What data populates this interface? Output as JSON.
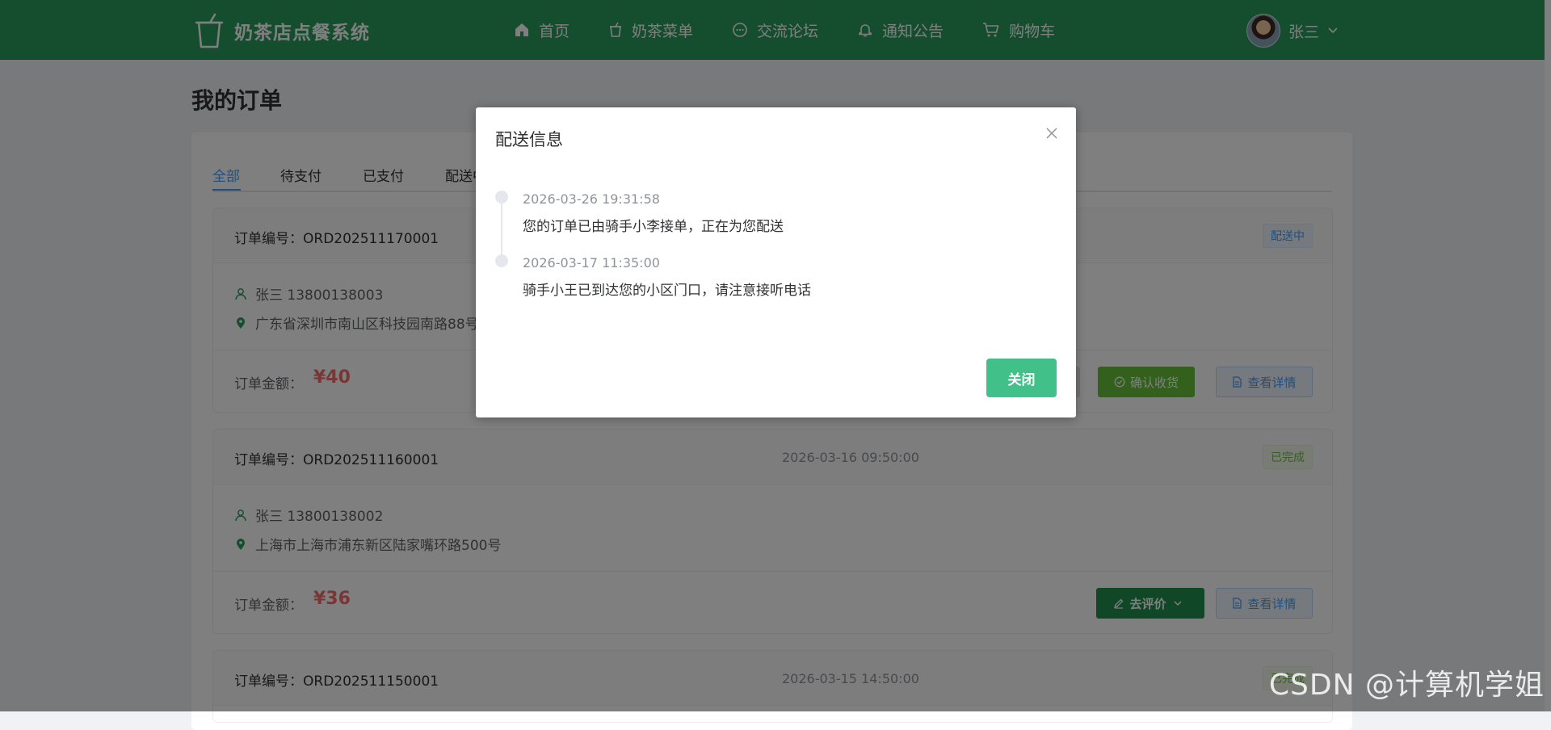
{
  "header": {
    "app_title": "奶茶店点餐系统",
    "nav": [
      {
        "label": "首页",
        "icon": "home-icon"
      },
      {
        "label": "奶茶菜单",
        "icon": "cup-icon"
      },
      {
        "label": "交流论坛",
        "icon": "chat-icon"
      },
      {
        "label": "通知公告",
        "icon": "bell-icon"
      },
      {
        "label": "购物车",
        "icon": "cart-icon"
      }
    ],
    "user_name": "张三"
  },
  "page": {
    "title": "我的订单",
    "tabs": [
      "全部",
      "待支付",
      "已支付",
      "配送中"
    ],
    "active_tab": "全部"
  },
  "orders": [
    {
      "label_no": "订单编号：",
      "order_no": "ORD202511170001",
      "time": "",
      "status": "配送中",
      "name_phone": "张三 13800138003",
      "address": "广东省深圳市南山区科技园南路88号",
      "amount_label": "订单金额：",
      "amount": "¥40",
      "action": "确认收货",
      "detail": "查看详情"
    },
    {
      "label_no": "订单编号：",
      "order_no": "ORD202511160001",
      "time": "2026-03-16 09:50:00",
      "status": "已完成",
      "name_phone": "张三 13800138002",
      "address": "上海市上海市浦东新区陆家嘴环路500号",
      "amount_label": "订单金额：",
      "amount": "¥36",
      "action": "去评价",
      "detail": "查看详情"
    },
    {
      "label_no": "订单编号：",
      "order_no": "ORD202511150001",
      "time": "2026-03-15 14:50:00",
      "status": "已完成"
    }
  ],
  "dialog": {
    "title": "配送信息",
    "events": [
      {
        "time": "2026-03-26 19:31:58",
        "text": "您的订单已由骑手小李接单，正在为您配送"
      },
      {
        "time": "2026-03-17 11:35:00",
        "text": "骑手小王已到达您的小区门口，请注意接听电话"
      }
    ],
    "close_label": "关闭"
  },
  "watermark": "CSDN @计算机学姐",
  "colors": {
    "brand": "#2a9d5c",
    "accent": "#409eff",
    "price": "#f56c6c",
    "dialog_button": "#42c08a"
  }
}
